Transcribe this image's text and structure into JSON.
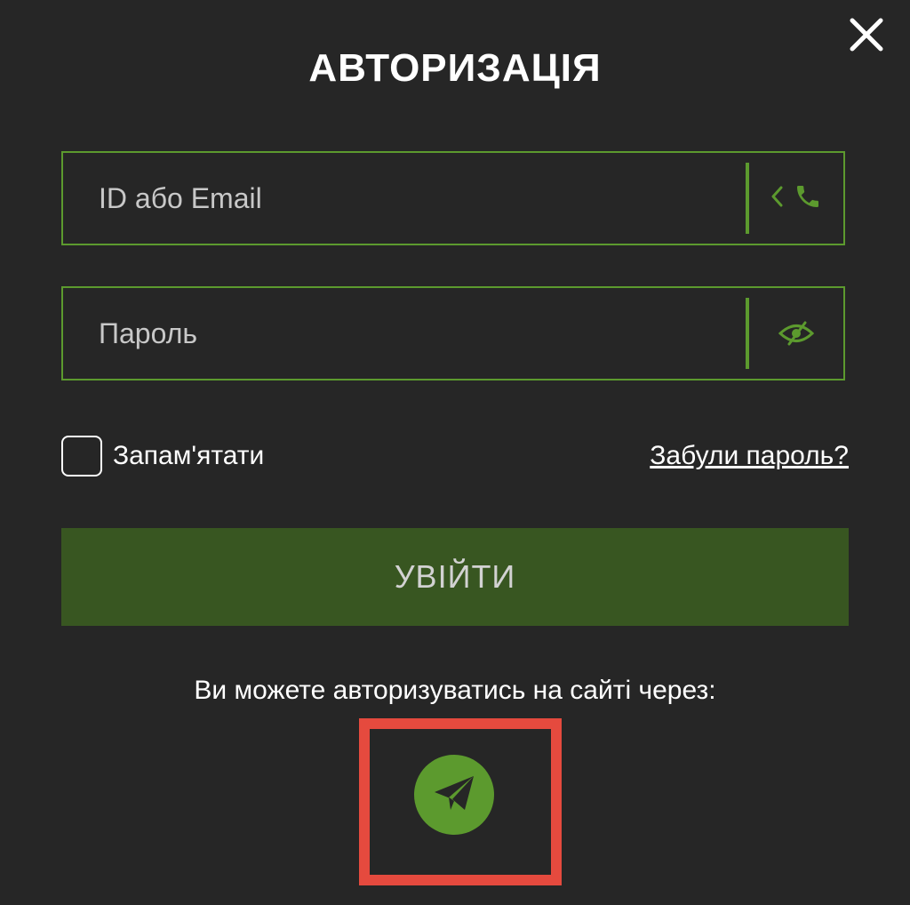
{
  "modal": {
    "title": "АВТОРИЗАЦІЯ",
    "close_icon": "close-icon"
  },
  "login_field": {
    "placeholder": "ID або Email",
    "value": "",
    "suffix_icons": [
      "chevron-left-icon",
      "phone-icon"
    ]
  },
  "password_field": {
    "placeholder": "Пароль",
    "value": "",
    "suffix_icon": "eye-slash-icon"
  },
  "remember": {
    "label": "Запам'ятати",
    "checked": false
  },
  "forgot_link": "Забули пароль?",
  "submit_label": "УВІЙТИ",
  "social": {
    "text": "Ви можете авторизуватись на сайті через:",
    "providers": [
      {
        "name": "Telegram",
        "icon": "telegram-icon"
      }
    ]
  },
  "colors": {
    "background": "#262626",
    "accent": "#5c9a2e",
    "button": "#385621",
    "highlight": "#e54a3e"
  }
}
